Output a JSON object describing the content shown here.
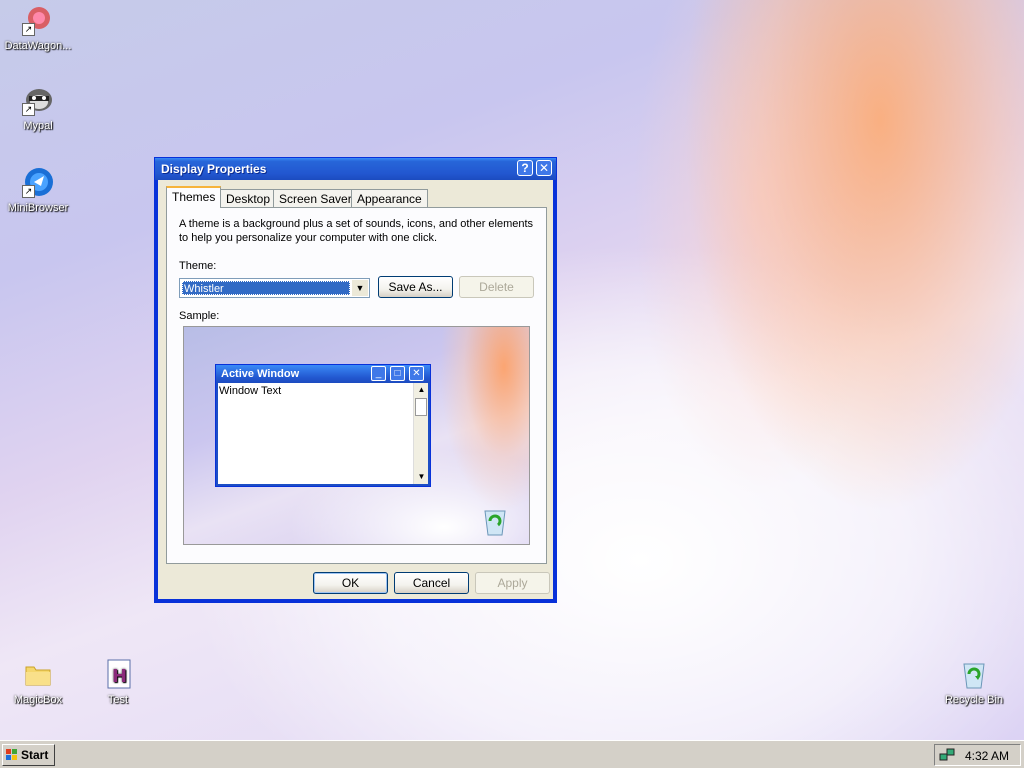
{
  "desktop": {
    "icons": [
      {
        "label": "DataWagon...",
        "icon": "datawagon-icon"
      },
      {
        "label": "Mypal",
        "icon": "mypal-raccoon-icon"
      },
      {
        "label": "MiniBrowser",
        "icon": "minibrowser-globe-icon"
      },
      {
        "label": "MagicBox",
        "icon": "folder-icon"
      },
      {
        "label": "Test",
        "icon": "h-document-icon"
      },
      {
        "label": "Recycle Bin",
        "icon": "recycle-bin-icon"
      }
    ]
  },
  "dialog": {
    "title": "Display Properties",
    "help_glyph": "?",
    "close_glyph": "✕",
    "tabs": [
      "Themes",
      "Desktop",
      "Screen Saver",
      "Appearance"
    ],
    "description_line1": "A theme is a background plus a set of sounds, icons, and other elements",
    "description_line2": "to help you personalize your computer with one click.",
    "theme_label": "Theme:",
    "theme_value": "Whistler",
    "save_as_label": "Save As...",
    "delete_label": "Delete",
    "sample_label": "Sample:",
    "sample": {
      "window_title": "Active Window",
      "window_text": "Window Text"
    },
    "ok_label": "OK",
    "cancel_label": "Cancel",
    "apply_label": "Apply"
  },
  "taskbar": {
    "start_label": "Start",
    "clock": "4:32 AM"
  },
  "colors": {
    "title_blue": "#2257d0",
    "selection": "#316ac5",
    "dialog_face": "#ece9d8",
    "tab_accent": "#f6b33b"
  }
}
